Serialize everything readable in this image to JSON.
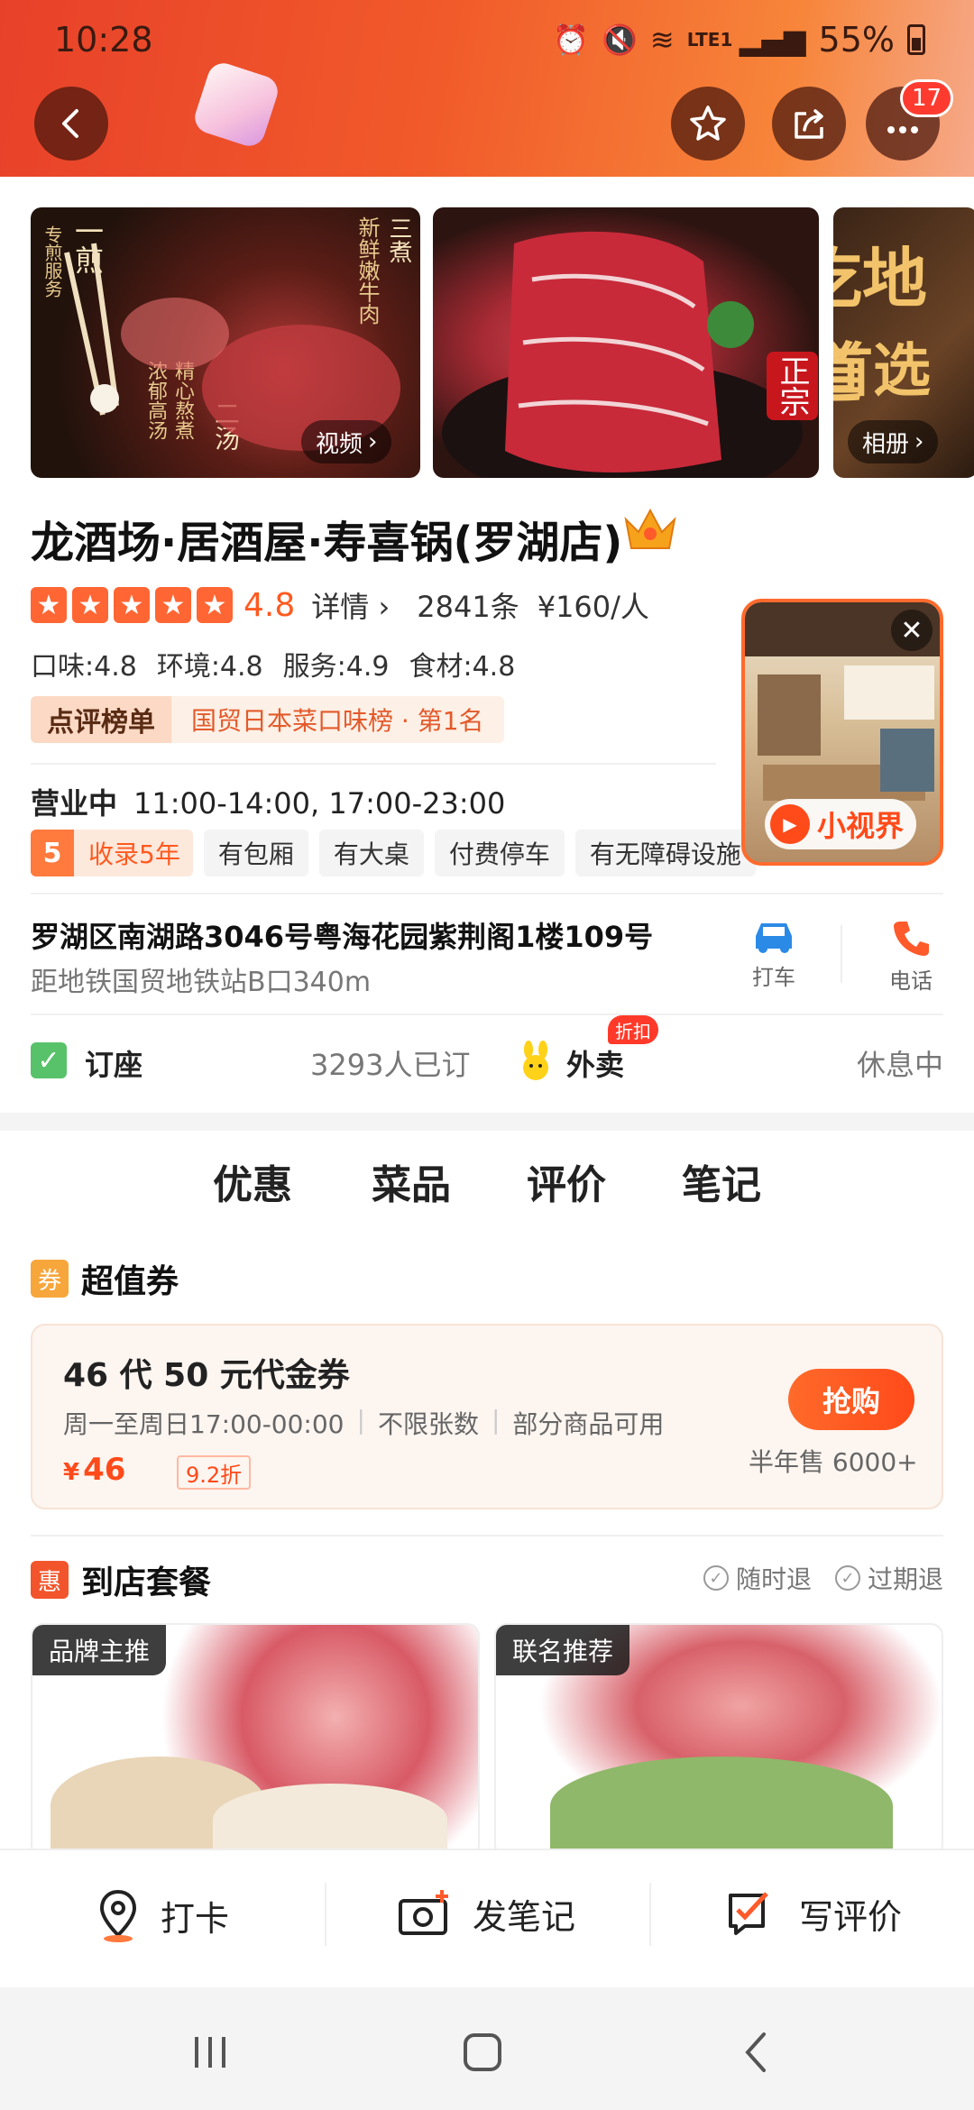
{
  "status_bar": {
    "time": "10:28",
    "network": "LTE1",
    "battery": "55%"
  },
  "header": {
    "notification_count": "17"
  },
  "gallery": {
    "photo1_text_a": "一煎",
    "photo1_text_b": "专煎服务",
    "photo1_text_c": "三煮",
    "photo1_text_d": "新鲜嫩牛肉",
    "photo1_text_e": "二汤",
    "photo1_text_f": "精心熬煮",
    "photo1_text_g": "浓郁高汤",
    "photo2_text": "正宗",
    "photo3_text": "吃地道",
    "photo3_text_b": "首选",
    "video_label": "视频",
    "album_label": "相册"
  },
  "store": {
    "name": "龙酒场·居酒屋·寿喜锅(罗湖店)",
    "rating": "4.8",
    "detail_link": "详情",
    "review_count": "2841条",
    "price": "¥160/人",
    "subscores": [
      "口味:4.8",
      "环境:4.8",
      "服务:4.9",
      "食材:4.8"
    ],
    "rank_label": "点评榜单",
    "rank_text": "国贸日本菜口味榜 · 第1名",
    "status": "营业中",
    "hours": "11:00-14:00, 17:00-23:00",
    "years_num": "5",
    "years_text": "收录5年",
    "tags": [
      "有包厢",
      "有大桌",
      "付费停车",
      "有无障碍设施"
    ],
    "mini_video_label": "小视界",
    "address": "罗湖区南湖路3046号粤海花园紫荆阁1楼109号",
    "distance": "距地铁国贸地铁站B口340m",
    "taxi_label": "打车",
    "phone_label": "电话",
    "booking_label": "订座",
    "booking_count": "3293人已订",
    "takeout_label": "外卖",
    "takeout_badge": "折扣",
    "takeout_status": "休息中"
  },
  "tabs": [
    "优惠",
    "菜品",
    "评价",
    "笔记"
  ],
  "coupon_section": {
    "badge": "券",
    "title": "超值券",
    "coupon_title": "46 代 50 元代金券",
    "meta": [
      "周一至周日17:00-00:00",
      "不限张数",
      "部分商品可用"
    ],
    "price_symbol": "¥",
    "price": "46",
    "discount": "9.2折",
    "buy_label": "抢购",
    "sold": "半年售 6000+"
  },
  "combo_section": {
    "badge": "惠",
    "title": "到店套餐",
    "policies": [
      "随时退",
      "过期退"
    ],
    "cards": [
      {
        "tag": "品牌主推"
      },
      {
        "tag": "联名推荐"
      }
    ]
  },
  "bottom_bar": {
    "checkin": "打卡",
    "post_note": "发笔记",
    "write_review": "写评价"
  },
  "colors": {
    "brand_orange": "#ff4a1a",
    "star_orange": "#ff6633",
    "header_gradient_start": "#e8412a"
  }
}
